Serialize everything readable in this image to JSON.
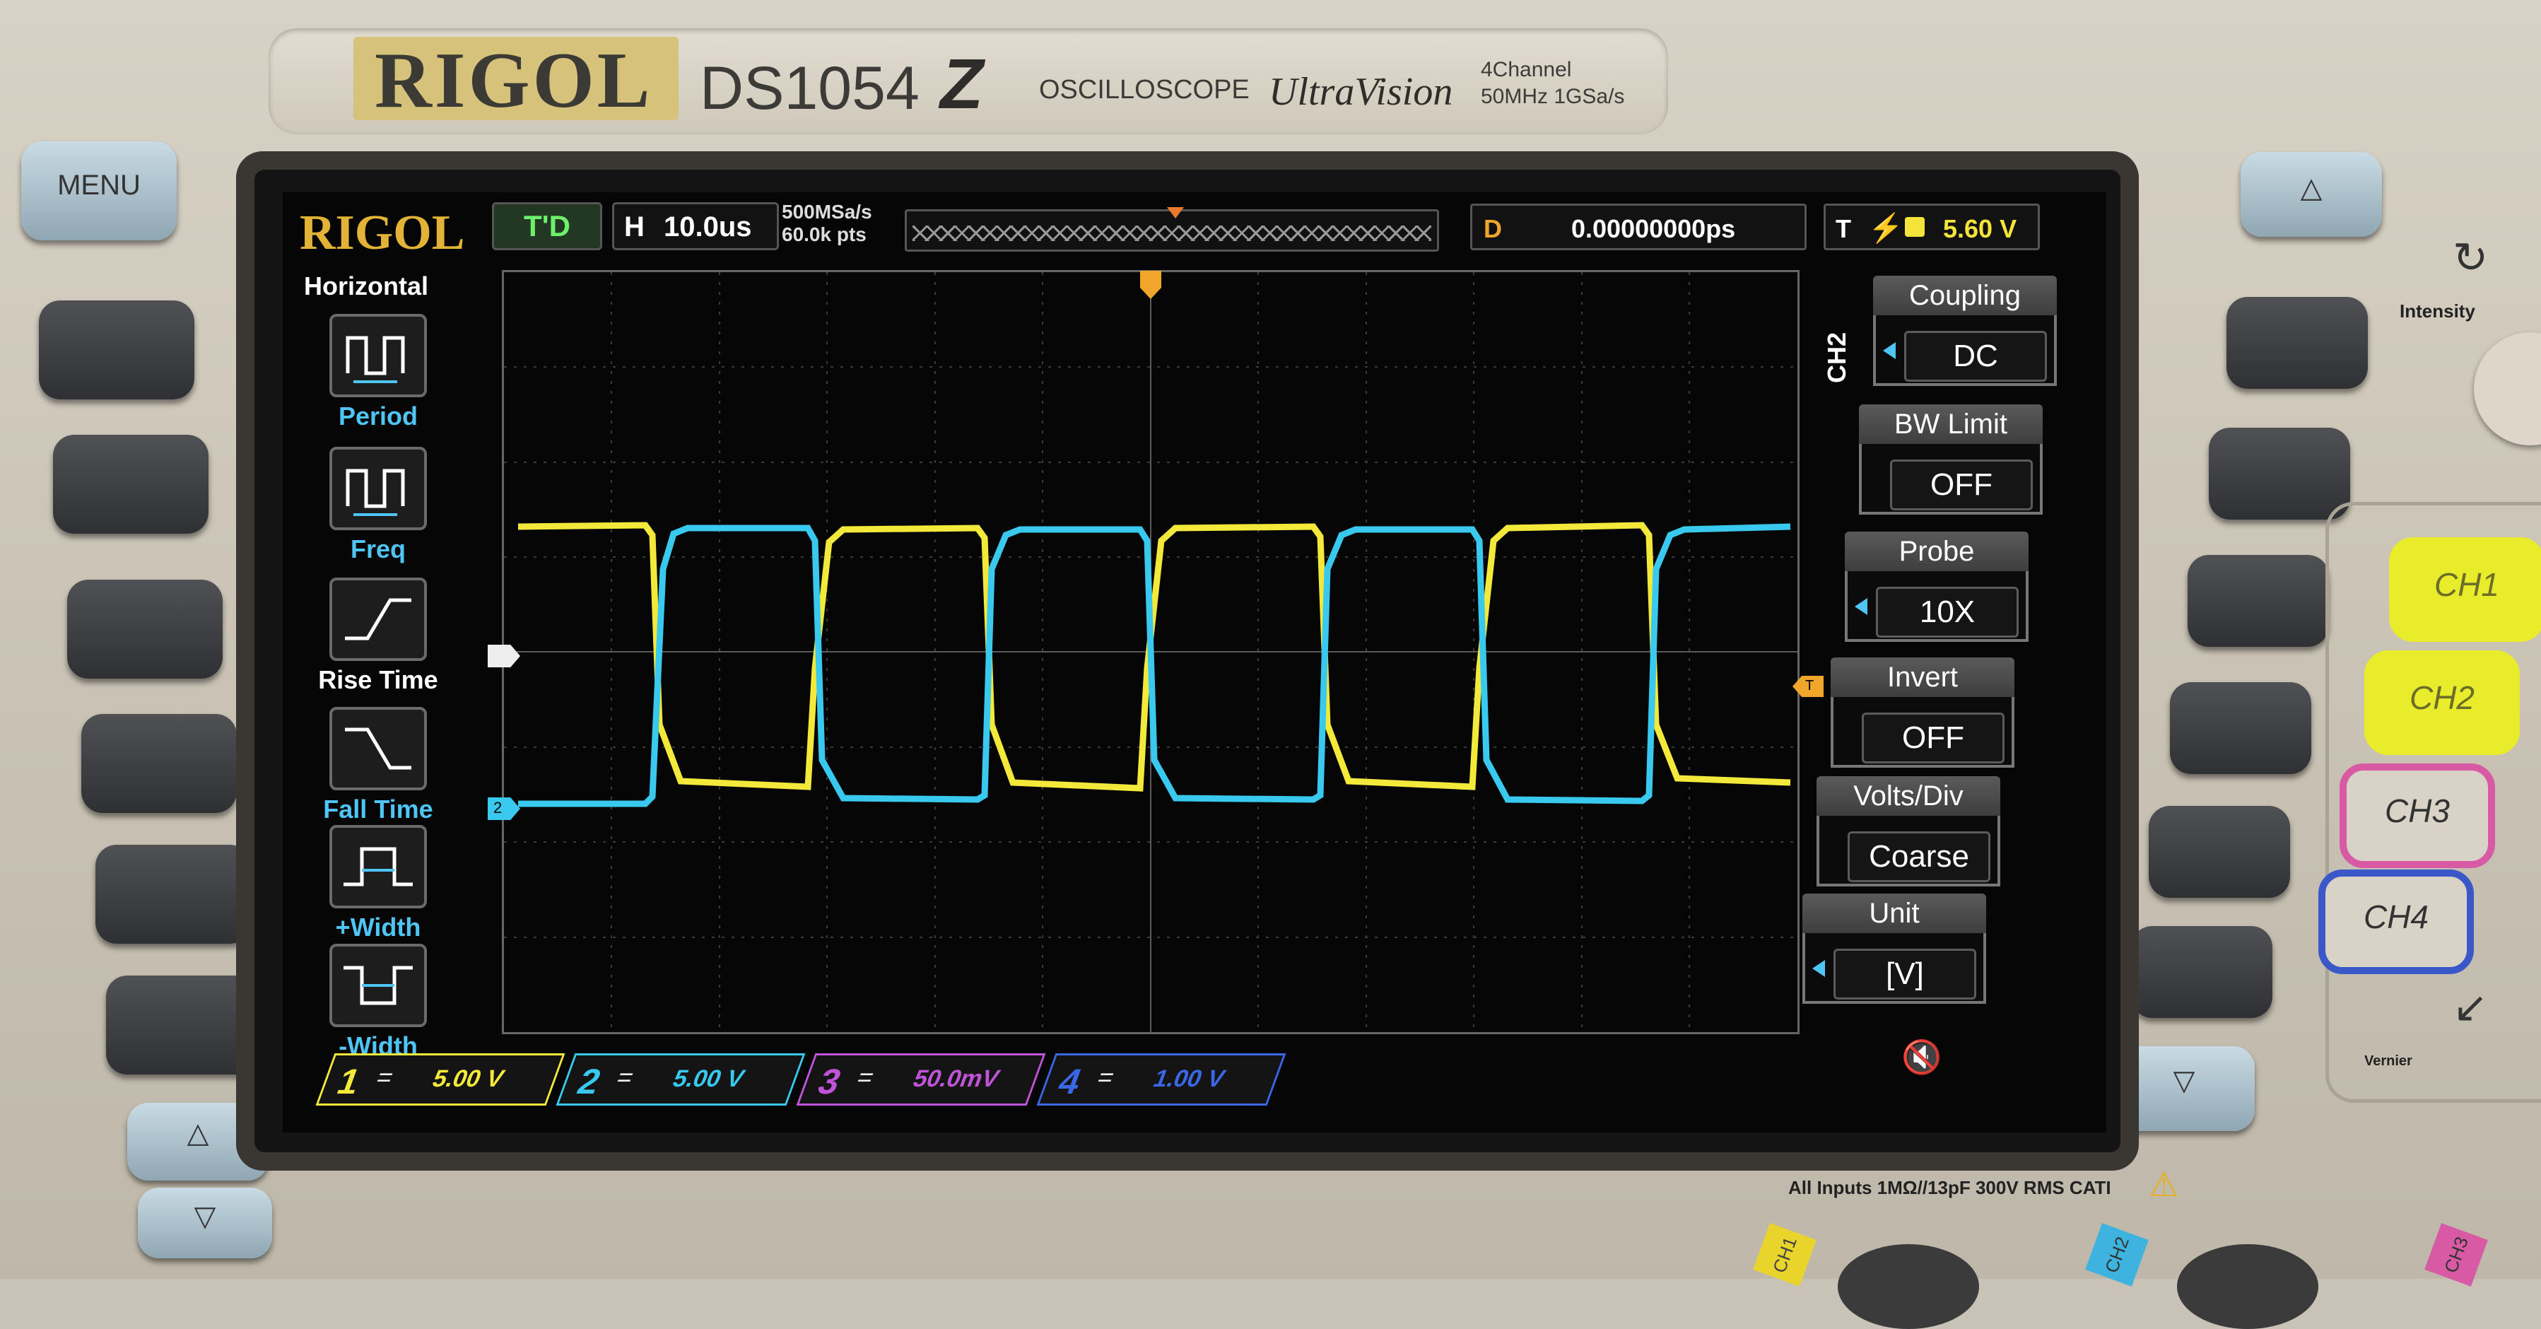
{
  "brand": {
    "name": "RIGOL",
    "model": "DS1054",
    "model_suffix": "Z",
    "product": "OSCILLOSCOPE",
    "series": "UltraVision",
    "spec_line1": "4Channel",
    "spec_line2": "50MHz  1GSa/s"
  },
  "topbar": {
    "logo": "RIGOL",
    "run_state": "T'D",
    "timebase_key": "H",
    "timebase_value": "10.0us",
    "sample_rate": "500MSa/s",
    "memory_depth": "60.0k pts",
    "delay_key": "D",
    "delay_value": "0.00000000ps",
    "trigger_key": "T",
    "trigger_edge_symbol": "⚡",
    "trigger_level": "5.60 V"
  },
  "left_menu": {
    "title": "Horizontal",
    "items": [
      {
        "label": "Period",
        "icon": "period-icon"
      },
      {
        "label": "Freq",
        "icon": "freq-icon"
      },
      {
        "label": "Rise Time",
        "icon": "rise-time-icon"
      },
      {
        "label": "Fall Time",
        "icon": "fall-time-icon"
      },
      {
        "label": "+Width",
        "icon": "pos-width-icon"
      },
      {
        "label": "-Width",
        "icon": "neg-width-icon"
      }
    ]
  },
  "right_menu": {
    "channel_label": "CH2",
    "items": [
      {
        "header": "Coupling",
        "value": "DC"
      },
      {
        "header": "BW Limit",
        "value": "OFF"
      },
      {
        "header": "Probe",
        "value": "10X"
      },
      {
        "header": "Invert",
        "value": "OFF"
      },
      {
        "header": "Volts/Div",
        "value": "Coarse"
      },
      {
        "header": "Unit",
        "value": "[V]"
      }
    ]
  },
  "bottom_bar": [
    {
      "num": "1",
      "coupling": "=",
      "scale": "5.00 V",
      "color": "#f2e93a"
    },
    {
      "num": "2",
      "coupling": "=",
      "scale": "5.00 V",
      "color": "#39c8ee"
    },
    {
      "num": "3",
      "coupling": "=",
      "scale": "50.0mV",
      "color": "#c054d8"
    },
    {
      "num": "4",
      "coupling": "=",
      "scale": "1.00 V",
      "color": "#3b67e6"
    }
  ],
  "markers": {
    "ch2_ground": "2",
    "trigger_level_marker": "T"
  },
  "front_panel": {
    "menu_button": "MENU",
    "intensity_label": "Intensity",
    "vernier_label": "Vernier",
    "channel_buttons": [
      "CH1",
      "CH2",
      "CH3",
      "CH4"
    ],
    "input_spec": "All Inputs 1MΩ//13pF 300V RMS  CATI",
    "bnc_labels": [
      "CH1",
      "CH2",
      "CH3"
    ]
  },
  "colors": {
    "ch1": "#f2e93a",
    "ch2": "#39c8ee",
    "ch3": "#c054d8",
    "ch4": "#3b67e6",
    "accent": "#e3b338"
  }
}
